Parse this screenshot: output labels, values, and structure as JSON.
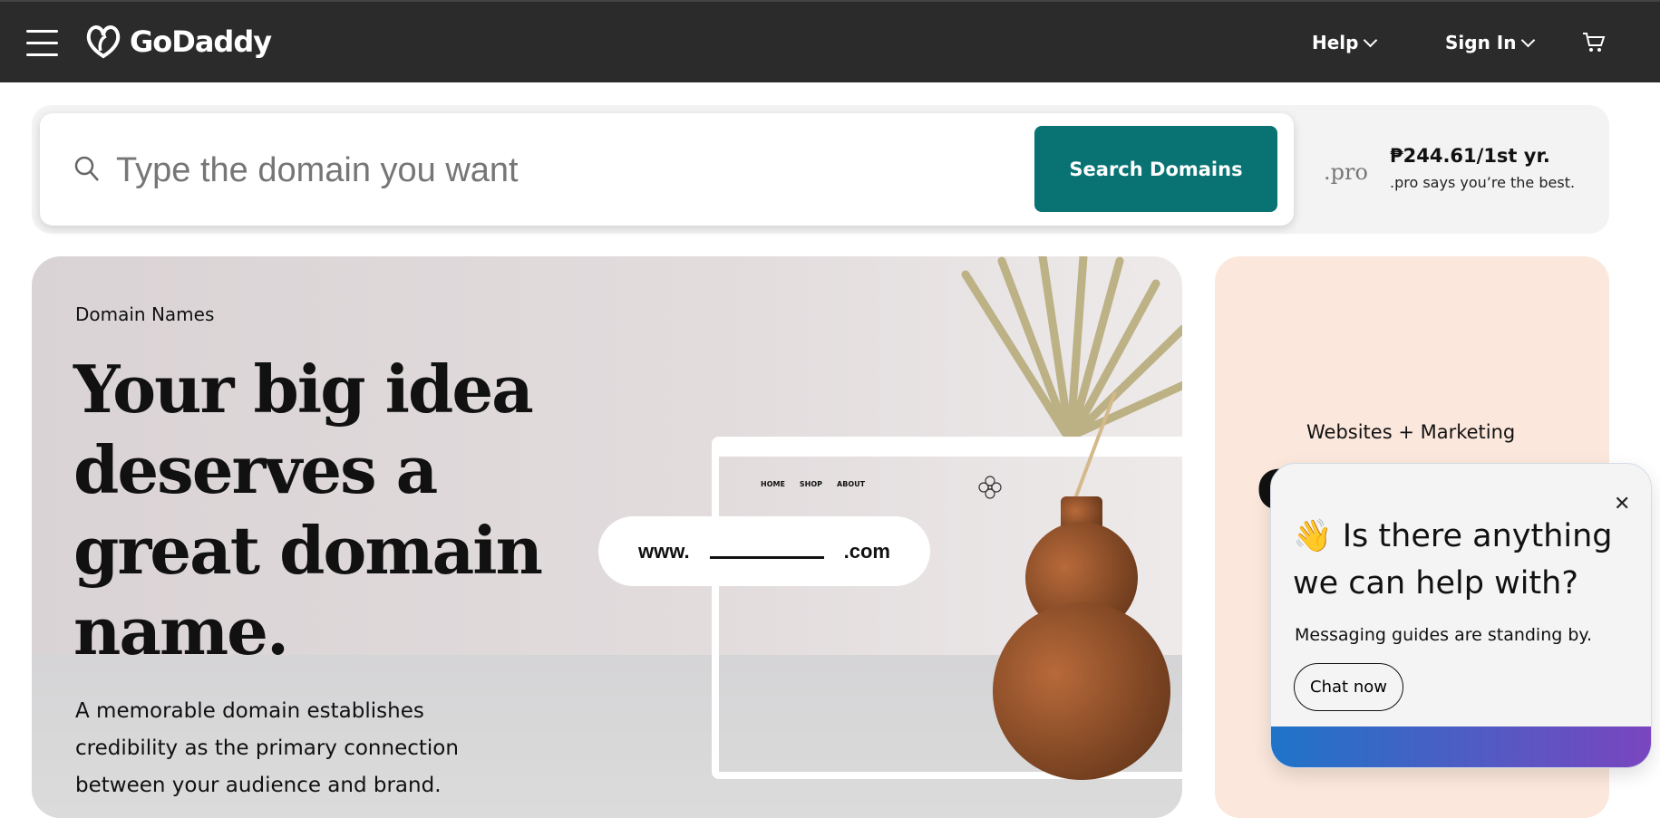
{
  "header": {
    "brand": "GoDaddy",
    "help": "Help",
    "sign_in": "Sign In"
  },
  "search": {
    "placeholder": "Type the domain you want",
    "button": "Search Domains"
  },
  "promo": {
    "tld": ".pro",
    "price": "₱244.61/1st yr.",
    "tagline": ".pro says you’re the best."
  },
  "hero": {
    "eyebrow": "Domain Names",
    "headline": "Your big idea deserves a great domain name.",
    "body": "A memorable domain establishes credibility as the primary connection between your audience and brand.",
    "mock_nav": [
      "HOME",
      "SHOP",
      "ABOUT"
    ],
    "url_prefix": "www.",
    "url_suffix": ".com"
  },
  "side_card": {
    "eyebrow": "Websites + Marketing",
    "headline_partial": "C"
  },
  "chat": {
    "emoji": "👋",
    "title": "Is there anything we can help with?",
    "subtitle": "Messaging guides are standing by.",
    "button": "Chat now"
  },
  "colors": {
    "header": "#2b2b2b",
    "accent": "#097373",
    "side_card": "#fbe7db"
  }
}
